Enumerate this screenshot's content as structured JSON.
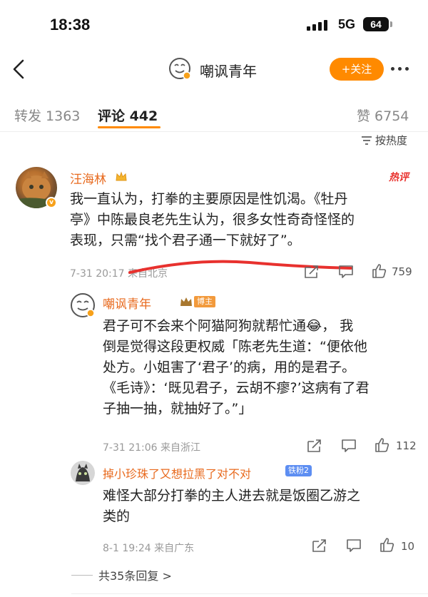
{
  "status_bar": {
    "time": "18:38",
    "network": "5G",
    "battery": "64"
  },
  "nav": {
    "title": "嘲讽青年",
    "follow_label": "+关注"
  },
  "tabs": {
    "repost": "转发 1363",
    "comment": "评论 442",
    "like": "赞 6754"
  },
  "sort_label": "按热度",
  "comments": [
    {
      "username": "汪海林",
      "hot_badge": "热评",
      "lines": [
        "我一直认为，打拳的主要原因是性饥渴。《牡丹",
        "亭》中陈最良老先生认为，很多女性奇奇怪怪的",
        "表现，只需“找个君子通一下就好了”。"
      ],
      "meta": "7-31 20:17 来自北京",
      "like_count": "759"
    },
    {
      "username": "嘲讽青年",
      "creator_label": "博主",
      "lines": [
        "君子可不会来个阿猫阿狗就帮忙通😂， 我",
        "倒是觉得这段更权威「陈老先生道：“便依他",
        "处方。小姐害了‘君子’的病，用的是君子。",
        "《毛诗》：‘既见君子，云胡不瘳?’这病有了君",
        "子抽一抽，就抽好了。”」"
      ],
      "meta": "7-31 21:06 来自浙江",
      "like_count": "112"
    },
    {
      "username": "掉小珍珠了又想拉黑了对不对",
      "fan_label": "铁粉2",
      "lines": [
        "难怪大部分打拳的主人进去就是饭圈乙游之",
        "类的"
      ],
      "meta": "8-1 19:24 来自广东",
      "like_count": "10"
    }
  ],
  "more_replies": "共35条回复 >",
  "colors": {
    "accent": "#ff8a00",
    "username": "#e86a1e",
    "annotation": "#e8312e"
  }
}
